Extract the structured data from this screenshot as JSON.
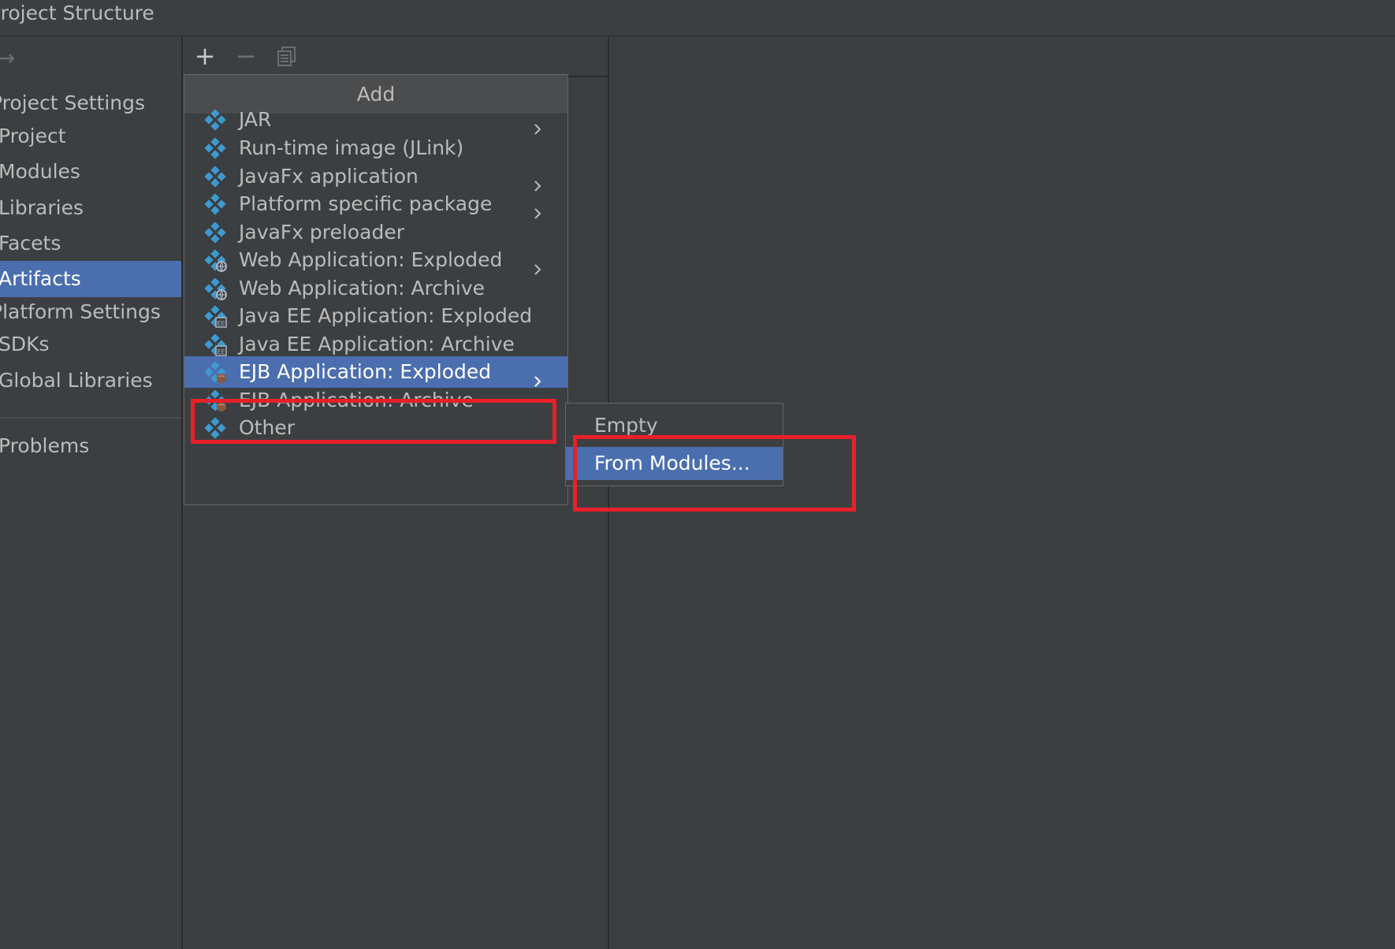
{
  "window": {
    "title": "Project Structure"
  },
  "sidebar": {
    "items": [
      {
        "label": "Project Settings",
        "kind": "header",
        "selected": false
      },
      {
        "label": "Project",
        "kind": "item",
        "selected": false
      },
      {
        "label": "Modules",
        "kind": "item",
        "selected": false
      },
      {
        "label": "Libraries",
        "kind": "item",
        "selected": false
      },
      {
        "label": "Facets",
        "kind": "item",
        "selected": false
      },
      {
        "label": "Artifacts",
        "kind": "item",
        "selected": true
      },
      {
        "label": "Platform Settings",
        "kind": "header",
        "selected": false
      },
      {
        "label": "SDKs",
        "kind": "item",
        "selected": false
      },
      {
        "label": "Global Libraries",
        "kind": "item",
        "selected": false
      },
      {
        "label": "Problems",
        "kind": "item",
        "selected": false
      }
    ]
  },
  "toolbar": {
    "add_icon": "plus-icon",
    "remove_icon": "minus-icon",
    "copy_icon": "copy-icon"
  },
  "add_menu": {
    "title": "Add",
    "items": [
      {
        "label": "JAR",
        "icon": "artifact-icon",
        "submenu": true,
        "selected": false
      },
      {
        "label": "Run-time image (JLink)",
        "icon": "artifact-icon",
        "submenu": false,
        "selected": false
      },
      {
        "label": "JavaFx application",
        "icon": "artifact-icon",
        "submenu": true,
        "selected": false
      },
      {
        "label": "Platform specific package",
        "icon": "artifact-icon",
        "submenu": true,
        "selected": false
      },
      {
        "label": "JavaFx preloader",
        "icon": "artifact-icon",
        "submenu": false,
        "selected": false
      },
      {
        "label": "Web Application: Exploded",
        "icon": "web-artifact-icon",
        "submenu": true,
        "selected": false
      },
      {
        "label": "Web Application: Archive",
        "icon": "web-artifact-icon",
        "submenu": false,
        "selected": false
      },
      {
        "label": "Java EE Application: Exploded",
        "icon": "javaee-artifact-icon",
        "submenu": false,
        "selected": false
      },
      {
        "label": "Java EE Application: Archive",
        "icon": "javaee-artifact-icon",
        "submenu": false,
        "selected": false
      },
      {
        "label": "EJB Application: Exploded",
        "icon": "ejb-artifact-icon",
        "submenu": true,
        "selected": true
      },
      {
        "label": "EJB Application: Archive",
        "icon": "ejb-artifact-icon",
        "submenu": false,
        "selected": false
      },
      {
        "label": "Other",
        "icon": "artifact-icon",
        "submenu": false,
        "selected": false
      }
    ]
  },
  "submenu": {
    "items": [
      {
        "label": "Empty",
        "selected": false
      },
      {
        "label": "From Modules...",
        "selected": true
      }
    ]
  },
  "colors": {
    "background": "#3c3f41",
    "selection": "#4b6eaf",
    "highlight_box": "#e8202a",
    "icon_blue": "#3d9ad1"
  }
}
